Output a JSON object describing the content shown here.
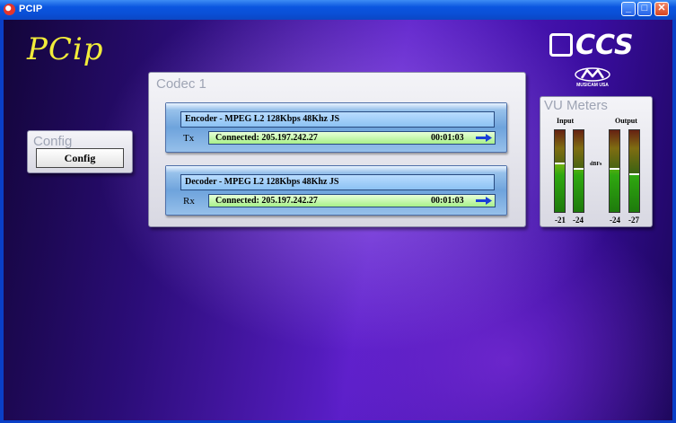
{
  "window": {
    "title": "PCIP",
    "buttons": {
      "minimize": "_",
      "maximize": "□",
      "close": "✕"
    }
  },
  "branding": {
    "app_logo": "PCip",
    "vendor_logo": "CCS",
    "vendor_sub": "MUSICAM USA"
  },
  "config_panel": {
    "title": "Config",
    "button_label": "Config"
  },
  "codec_panel": {
    "title": "Codec 1",
    "encoder": {
      "header": "Encoder -  MPEG L2 128Kbps 48Khz JS",
      "direction": "Tx",
      "status": "Connected: 205.197.242.27",
      "time": "00:01:03",
      "icon": "arrow-right-icon"
    },
    "decoder": {
      "header": "Decoder -  MPEG L2 128Kbps 48Khz JS",
      "direction": "Rx",
      "status": "Connected: 205.197.242.27",
      "time": "00:01:03",
      "icon": "arrow-right-icon"
    }
  },
  "vu_meters": {
    "title": "VU Meters",
    "input_label": "Input",
    "output_label": "Output",
    "unit_label": "dBFs",
    "input_values": [
      "-21",
      "-24"
    ],
    "output_values": [
      "-24",
      "-27"
    ],
    "colors": {
      "high": "#9a1a10",
      "mid": "#d0c010",
      "low": "#2fa810"
    }
  }
}
